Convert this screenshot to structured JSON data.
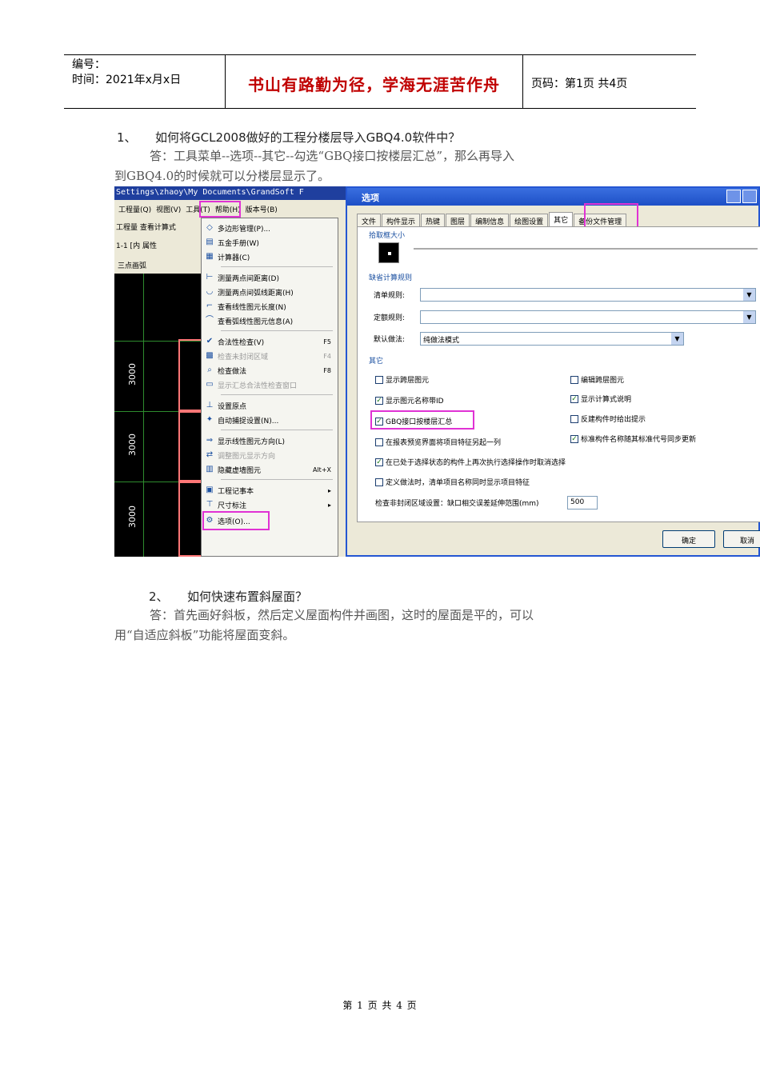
{
  "header": {
    "number_label": "编号：",
    "time_label": "时间：2021年x月x日",
    "motto": "书山有路勤为径，学海无涯苦作舟",
    "page_info": "页码：第1页  共4页"
  },
  "q1": {
    "number": "1、",
    "question": "如何将GCL2008做好的工程分楼层导入GBQ4.0软件中？",
    "answer_line1": "答：工具菜单--选项--其它--勾选“GBQ接口按楼层汇总”，那么再导入",
    "answer_line2": "到GBQ4.0的时候就可以分楼层显示了。"
  },
  "screenshot": {
    "path": "Settings\\zhaoy\\My Documents\\GrandSoft F",
    "menubar": [
      "工程量(Q)",
      "视图(V)",
      "工具(T)",
      "帮助(H)",
      "版本号(B)"
    ],
    "toolbar1": "工程量",
    "toolbar1b": "查看计算式",
    "toolbar2": "1-1 [内",
    "toolbar2b": "属性",
    "toolbar3": "三点画弧",
    "dims": [
      "3000",
      "3000",
      "3000"
    ],
    "tools_menu": [
      {
        "label": "多边形管理(P)...",
        "shortcut": "",
        "disabled": false
      },
      {
        "label": "五金手册(W)",
        "shortcut": "",
        "disabled": false
      },
      {
        "label": "计算器(C)",
        "shortcut": "",
        "disabled": false
      },
      {
        "label": "测量两点间距离(D)",
        "shortcut": "",
        "disabled": false
      },
      {
        "label": "测量两点间弧线距离(H)",
        "shortcut": "",
        "disabled": false
      },
      {
        "label": "查看线性图元长度(N)",
        "shortcut": "",
        "disabled": false
      },
      {
        "label": "查看弧线性图元信息(A)",
        "shortcut": "",
        "disabled": false
      },
      {
        "label": "合法性检查(V)",
        "shortcut": "F5",
        "disabled": false
      },
      {
        "label": "检查未封闭区域",
        "shortcut": "F4",
        "disabled": true
      },
      {
        "label": "检查做法",
        "shortcut": "F8",
        "disabled": false
      },
      {
        "label": "显示汇总合法性检查窗口",
        "shortcut": "",
        "disabled": true
      },
      {
        "label": "设置原点",
        "shortcut": "",
        "disabled": false
      },
      {
        "label": "自动捕捉设置(N)...",
        "shortcut": "",
        "disabled": false
      },
      {
        "label": "显示线性图元方向(L)",
        "shortcut": "",
        "disabled": false
      },
      {
        "label": "调整图元显示方向",
        "shortcut": "",
        "disabled": true
      },
      {
        "label": "隐藏虚墙图元",
        "shortcut": "Alt+X",
        "disabled": false
      },
      {
        "label": "工程记事本",
        "shortcut": "▸",
        "disabled": false
      },
      {
        "label": "尺寸标注",
        "shortcut": "▸",
        "disabled": false
      },
      {
        "label": "选项(O)...",
        "shortcut": "",
        "disabled": false
      }
    ],
    "dialog": {
      "title": "选项",
      "tabs": [
        "文件",
        "构件显示",
        "热键",
        "图层",
        "编制信息",
        "绘图设置",
        "其它",
        "备份文件管理"
      ],
      "active_tab": "其它",
      "group_pick": "拾取框大小",
      "group_rules": "缺省计算规则",
      "list_rule_label": "清单规则:",
      "quota_rule_label": "定额规则:",
      "default_method_label": "默认做法:",
      "default_method_value": "纯做法模式",
      "group_other": "其它",
      "checkboxes": [
        {
          "label": "显示跨层图元",
          "checked": false
        },
        {
          "label": "编辑跨层图元",
          "checked": false
        },
        {
          "label": "显示图元名称带ID",
          "checked": true
        },
        {
          "label": "显示计算式说明",
          "checked": true
        },
        {
          "label": "GBQ接口按楼层汇总",
          "checked": true
        },
        {
          "label": "反建构件时给出提示",
          "checked": false
        },
        {
          "label": "在报表预览界面将项目特征另起一列",
          "checked": false
        },
        {
          "label": "标准构件名称随其标准代号同步更新",
          "checked": true
        },
        {
          "label": "在已处于选择状态的构件上再次执行选择操作时取消选择",
          "checked": true
        },
        {
          "label": "定义做法时，清单项目名称同时显示项目特征",
          "checked": false
        }
      ],
      "check_label": "检查非封闭区域设置：缺口相交误差延伸范围(mm)",
      "check_value": "500",
      "ok": "确定",
      "cancel": "取消"
    }
  },
  "q2": {
    "number": "2、",
    "question": "如何快速布置斜屋面？",
    "answer_line1": "答：首先画好斜板，然后定义屋面构件并画图，这时的屋面是平的，可以",
    "answer_line2": "用“自适应斜板”功能将屋面变斜。"
  },
  "footer": "第 1 页 共 4 页"
}
